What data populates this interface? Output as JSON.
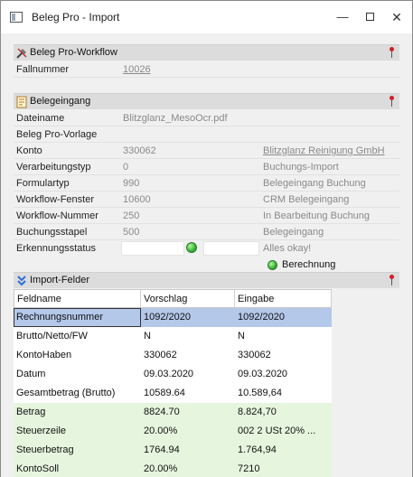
{
  "window": {
    "title": "Beleg Pro - Import",
    "minimize": "—",
    "close": "✕"
  },
  "workflow_section": {
    "title": "Beleg Pro-Workflow",
    "rows": [
      {
        "label": "Fallnummer",
        "value": "10026"
      }
    ]
  },
  "belegeingang_section": {
    "title": "Belegeingang",
    "rows": [
      {
        "label": "Dateiname",
        "value": "Blitzglanz_MesoOcr.pdf",
        "extra": ""
      },
      {
        "label": "Beleg Pro-Vorlage",
        "value": "",
        "extra": ""
      },
      {
        "label": "Konto",
        "value": "330062",
        "extra": "Blitzglanz Reinigung GmbH"
      },
      {
        "label": "Verarbeitungstyp",
        "value": "0",
        "extra": "Buchungs-Import"
      },
      {
        "label": "Formulartyp",
        "value": "990",
        "extra": "Belegeingang Buchung"
      },
      {
        "label": "Workflow-Fenster",
        "value": "10600",
        "extra": "CRM Belegeingang"
      },
      {
        "label": "Workflow-Nummer",
        "value": "250",
        "extra": "In Bearbeitung Buchung"
      },
      {
        "label": "Buchungsstapel",
        "value": "500",
        "extra": "Belegeingang"
      },
      {
        "label": "Erkennungsstatus",
        "value": "",
        "extra": "Alles okay!"
      }
    ],
    "status_action": "Berechnung"
  },
  "import_section": {
    "title": "Import-Felder",
    "columns": [
      "Feldname",
      "Vorschlag",
      "Eingabe"
    ],
    "rows": [
      {
        "feldname": "Rechnungsnummer",
        "vorschlag": "1092/2020",
        "eingabe": "1092/2020",
        "state": "selected"
      },
      {
        "feldname": "Brutto/Netto/FW",
        "vorschlag": "N",
        "eingabe": "N",
        "state": "white"
      },
      {
        "feldname": "KontoHaben",
        "vorschlag": "330062",
        "eingabe": "330062",
        "state": "white"
      },
      {
        "feldname": "Datum",
        "vorschlag": "09.03.2020",
        "eingabe": "09.03.2020",
        "state": "white"
      },
      {
        "feldname": "Gesamtbetrag (Brutto)",
        "vorschlag": "10589.64",
        "eingabe": "10.589,64",
        "state": "white"
      },
      {
        "feldname": "Betrag",
        "vorschlag": "8824.70",
        "eingabe": "8.824,70",
        "state": "green"
      },
      {
        "feldname": "Steuerzeile",
        "vorschlag": "20.00%",
        "eingabe": "002 2   USt 20% ...",
        "state": "green"
      },
      {
        "feldname": "Steuerbetrag",
        "vorschlag": "1764.94",
        "eingabe": "1.764,94",
        "state": "green"
      },
      {
        "feldname": "KontoSoll",
        "vorschlag": "20.00%",
        "eingabe": "7210",
        "state": "green"
      }
    ]
  },
  "icons": {
    "app": "window-icon",
    "workflow": "tools-icon",
    "belegeingang": "document-icon",
    "import": "chevron-double-down-icon",
    "pin": "pin-icon",
    "status": "green-status-icon"
  },
  "colors": {
    "selected_row": "#b4c8ea",
    "green_row": "#e6f6de",
    "section_header": "#dcdcdc",
    "pin": "#d0202a"
  }
}
